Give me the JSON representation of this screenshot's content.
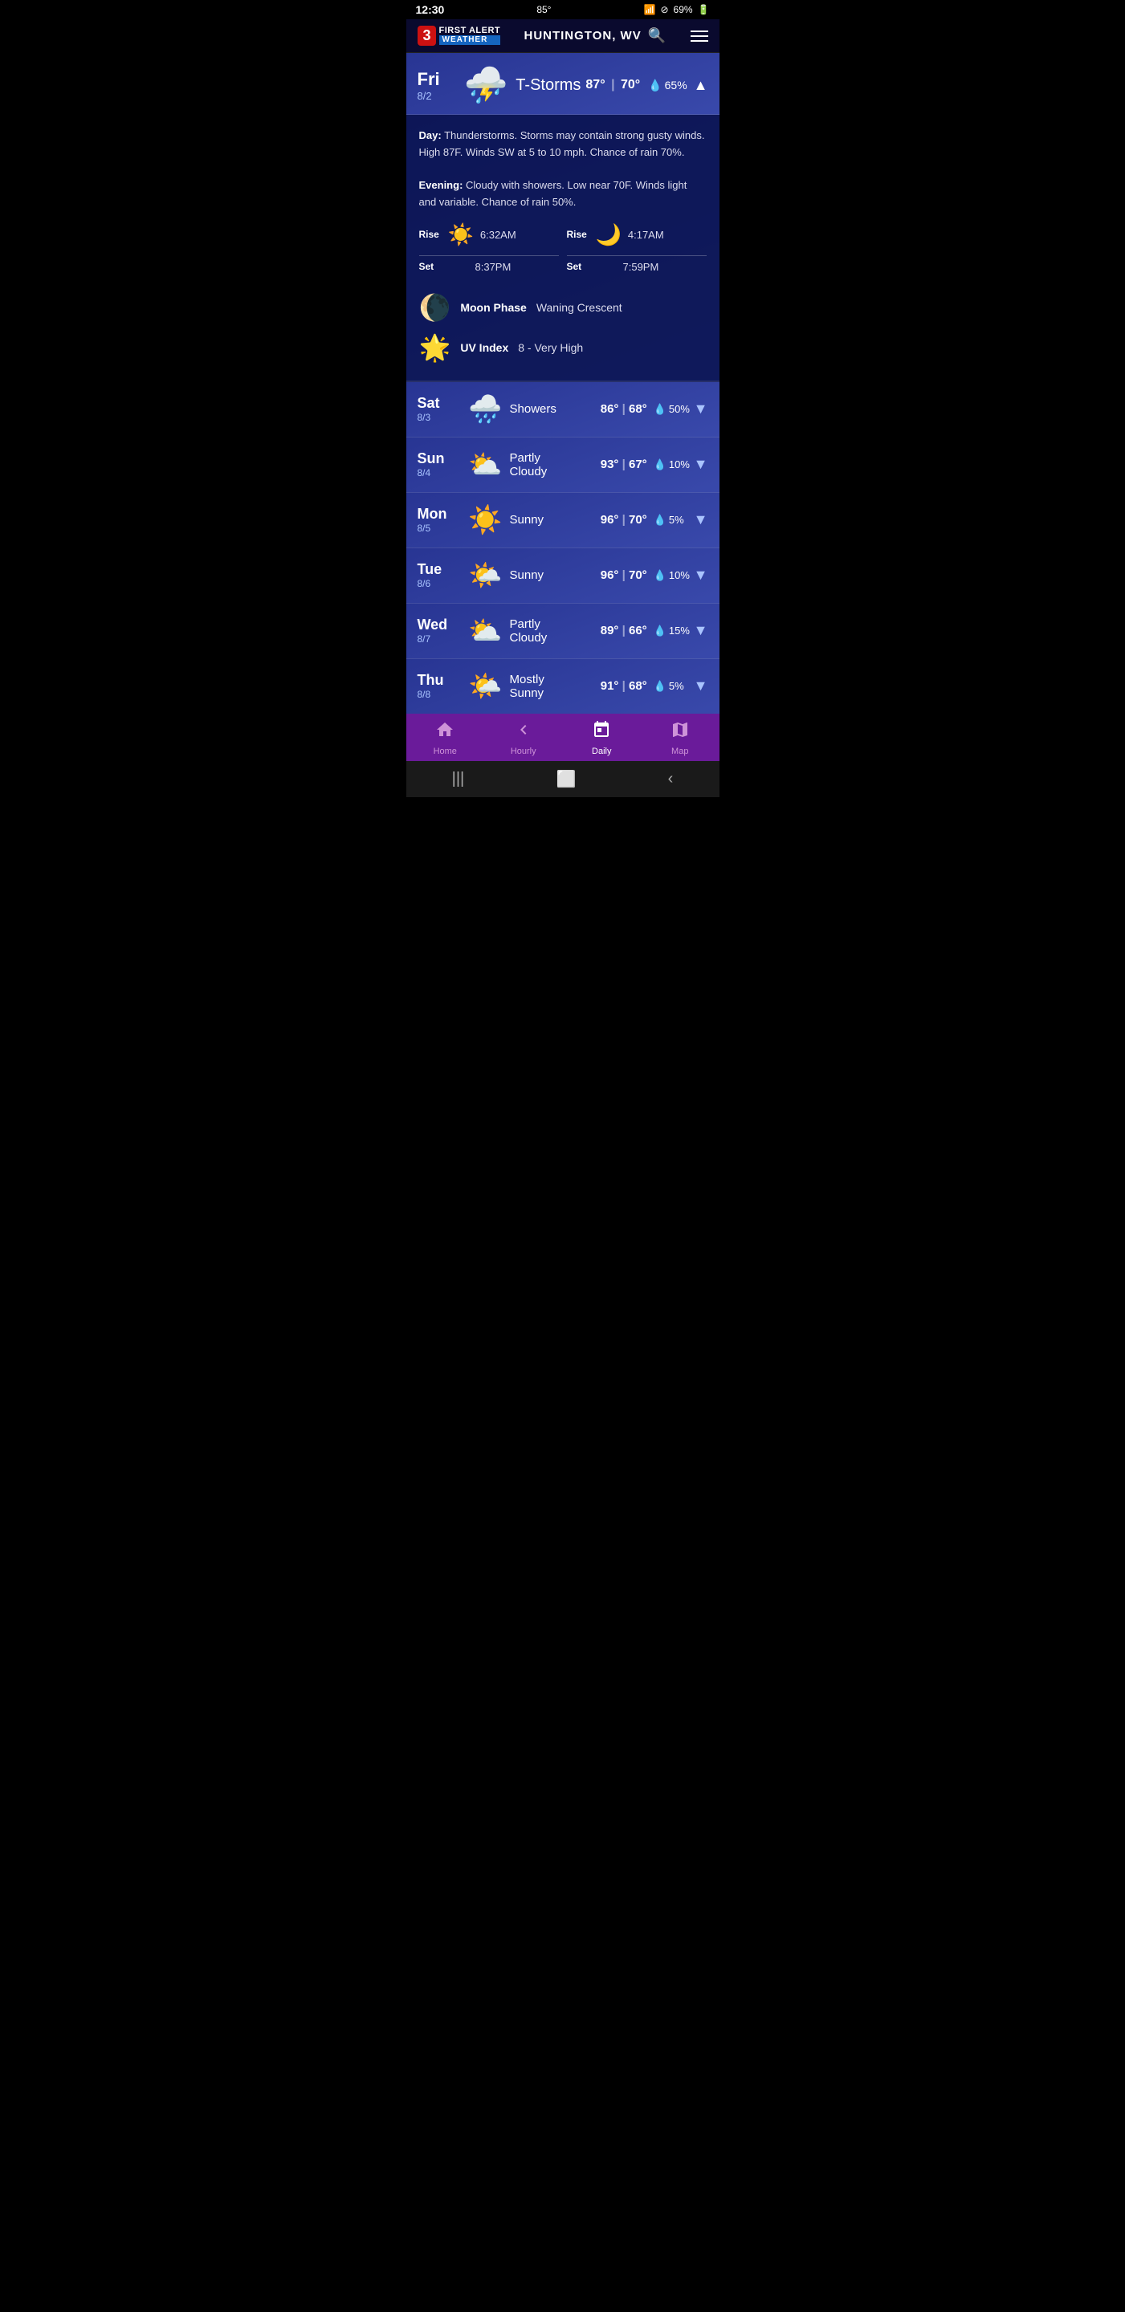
{
  "status_bar": {
    "time": "12:30",
    "temp": "85°",
    "wifi": "📶",
    "battery": "69%"
  },
  "header": {
    "logo_number": "3",
    "logo_first": "FIRST ALERT",
    "logo_weather": "WEATHER",
    "location": "HUNTINGTON, WV",
    "search_label": "search"
  },
  "expanded_day": {
    "day_name": "Fri",
    "day_date": "8/2",
    "condition": "T-Storms",
    "high": "87°",
    "low": "70°",
    "precip": "65%",
    "detail_day": "Day:",
    "detail_day_text": "Thunderstorms. Storms may contain strong gusty winds. High 87F. Winds SW at 5 to 10 mph. Chance of rain 70%.",
    "detail_eve": "Evening:",
    "detail_eve_text": "Cloudy with showers. Low near 70F. Winds light and variable. Chance of rain 50%.",
    "sun_rise_label": "Rise",
    "sun_rise_time": "6:32AM",
    "sun_set_label": "Set",
    "sun_set_time": "8:37PM",
    "moon_rise_time": "4:17AM",
    "moon_set_time": "7:59PM",
    "moon_phase_label": "Moon Phase",
    "moon_phase_value": "Waning Crescent",
    "uv_label": "UV Index",
    "uv_value": "8 - Very High"
  },
  "forecast": [
    {
      "day_name": "Sat",
      "day_date": "8/3",
      "condition": "Showers",
      "high": "86°",
      "low": "68°",
      "precip": "50%",
      "icon": "🌧️"
    },
    {
      "day_name": "Sun",
      "day_date": "8/4",
      "condition": "Partly\nCloudy",
      "high": "93°",
      "low": "67°",
      "precip": "10%",
      "icon": "⛅"
    },
    {
      "day_name": "Mon",
      "day_date": "8/5",
      "condition": "Sunny",
      "high": "96°",
      "low": "70°",
      "precip": "5%",
      "icon": "☀️"
    },
    {
      "day_name": "Tue",
      "day_date": "8/6",
      "condition": "Sunny",
      "high": "96°",
      "low": "70°",
      "precip": "10%",
      "icon": "🌤️"
    },
    {
      "day_name": "Wed",
      "day_date": "8/7",
      "condition": "Partly\nCloudy",
      "high": "89°",
      "low": "66°",
      "precip": "15%",
      "icon": "⛅"
    },
    {
      "day_name": "Thu",
      "day_date": "8/8",
      "condition": "Mostly\nSunny",
      "high": "91°",
      "low": "68°",
      "precip": "5%",
      "icon": "🌤️"
    }
  ],
  "bottom_nav": {
    "items": [
      {
        "label": "Home",
        "icon": "🏠",
        "active": false
      },
      {
        "label": "Hourly",
        "icon": "◀",
        "active": false
      },
      {
        "label": "Daily",
        "icon": "📅",
        "active": true
      },
      {
        "label": "Map",
        "icon": "🗺️",
        "active": false
      }
    ]
  },
  "android_nav": {
    "back": "‹",
    "home": "⬜",
    "recent": "|||"
  }
}
